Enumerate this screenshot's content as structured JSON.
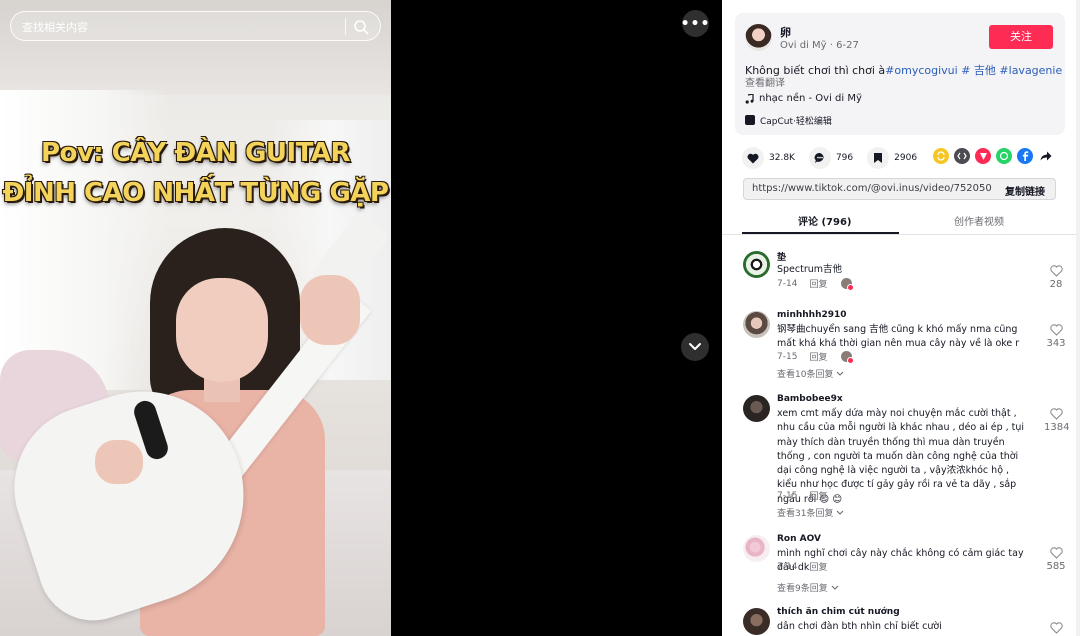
{
  "search": {
    "placeholder": "查找相关内容"
  },
  "video": {
    "overlay_line1": "Pov: CÂY ĐÀN GUITAR",
    "overlay_line2": "ĐỈNH CAO NHẤT TỪNG GẶP",
    "more_label": "•••"
  },
  "author": {
    "name": "卵",
    "meta": "Ovi di Mỹ · 6-27",
    "follow_label": "关注"
  },
  "description": {
    "text": "Không biết chơi thì chơi à",
    "tags": [
      "#omycogivui",
      " # 吉他",
      " #lavagenie"
    ],
    "translate": "查看翻译",
    "music": "nhạc nền - Ovi di Mỹ",
    "capcut": "CapCut·轻松编辑"
  },
  "stats": {
    "likes": "32.8K",
    "comments": "796",
    "saves": "2906"
  },
  "share_icons": [
    "repost-icon",
    "embed-icon",
    "send-icon",
    "whatsapp-icon",
    "facebook-icon",
    "share-arrow-icon"
  ],
  "colors": {
    "accent": "#fe2c55",
    "hashtag": "#2b5db9",
    "repost": "#f7c625",
    "embed": "#4b4b52",
    "send": "#fe2c55",
    "whatsapp": "#25d366",
    "facebook": "#1877f2"
  },
  "link": {
    "url": "https://www.tiktok.com/@ovi.inus/video/75205005994...",
    "copy_label": "复制链接"
  },
  "tabs": {
    "comments": "评论 (796)",
    "creator": "创作者视频"
  },
  "comments": [
    {
      "user": "垫",
      "text": "Spectrum吉他",
      "date": "7-14",
      "reply": "回复",
      "likes": "28",
      "replies": ""
    },
    {
      "user": "minhhhh2910",
      "text": "钢琴曲chuyển sang 吉他 cũng k khó mấy nma cũng mất khá khá thời gian nên mua cây này về là oke r",
      "date": "7-15",
      "reply": "回复",
      "likes": "343",
      "replies": "查看10条回复"
    },
    {
      "user": "Bambobee9x",
      "text": "xem cmt mấy dứa mày noi chuyện mắc cười thật , nhu cầu của mỗi người là khác nhau , déo ai ép , tụi mày thích dàn truyền thống thì mua dàn truyền thống , con người ta muốn dàn công nghệ của thời dại công nghệ là việc người ta , vậy浓浓khóc hộ , kiểu như học được tí gảy gảy rồi ra vẻ ta dãy , sắp ngầu rồi 😊 😊",
      "date": "7-15",
      "reply": "回复",
      "likes": "1384",
      "replies": "查看31条回复"
    },
    {
      "user": "Ron AOV",
      "text": "mình nghĩ chơi cây này chắc không có cảm giác tay đâu dk",
      "date": "7-14",
      "reply": "回复",
      "likes": "585",
      "replies": "查看9条回复"
    },
    {
      "user": "thích ăn chim cút nướng",
      "text": "dân chơi đàn bth nhìn chỉ biết cười",
      "date": "",
      "reply": "",
      "likes": "",
      "replies": ""
    }
  ]
}
